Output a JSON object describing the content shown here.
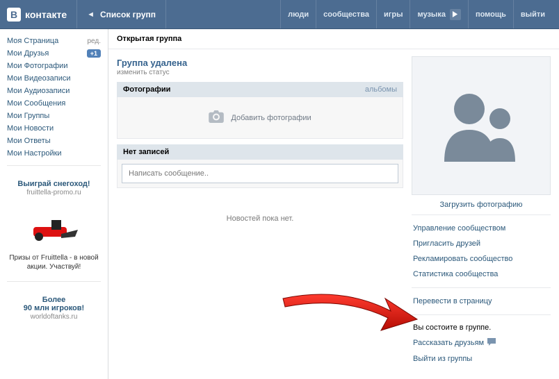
{
  "header": {
    "logo_text": "контакте",
    "logo_letter": "В",
    "crumb": "Список групп",
    "links": {
      "people": "люди",
      "communities": "сообщества",
      "games": "игры",
      "music": "музыка",
      "help": "помощь",
      "logout": "выйти"
    }
  },
  "sidebar": {
    "items": [
      {
        "label": "Моя Страница",
        "tag": "ред."
      },
      {
        "label": "Мои Друзья",
        "badge": "+1"
      },
      {
        "label": "Мои Фотографии"
      },
      {
        "label": "Мои Видеозаписи"
      },
      {
        "label": "Мои Аудиозаписи"
      },
      {
        "label": "Мои Сообщения"
      },
      {
        "label": "Мои Группы"
      },
      {
        "label": "Мои Новости"
      },
      {
        "label": "Мои Ответы"
      },
      {
        "label": "Мои Настройки"
      }
    ],
    "ad1": {
      "title": "Выиграй снегоход!",
      "domain": "fruittella-promo.ru",
      "text": "Призы от Fruittella - в новой акции. Участвуй!"
    },
    "ad2": {
      "title": "Более",
      "subtitle": "90 млн игроков!",
      "domain": "worldoftanks.ru"
    }
  },
  "page": {
    "title": "Открытая группа",
    "group_name": "Группа удалена",
    "status_edit": "изменить статус",
    "photos": {
      "header": "Фотографии",
      "albums": "альбомы",
      "add": "Добавить фотографии"
    },
    "wall": {
      "header": "Нет записей",
      "placeholder": "Написать сообщение..",
      "empty": "Новостей пока нет."
    }
  },
  "right": {
    "upload": "Загрузить фотографию",
    "manage": {
      "community": "Управление сообществом",
      "invite": "Пригласить друзей",
      "advertise": "Рекламировать сообщество",
      "stats": "Статистика сообщества"
    },
    "convert": "Перевести в страницу",
    "member_status": "Вы состоите в группе.",
    "tell_friends": "Рассказать друзьям",
    "leave": "Выйти из группы"
  }
}
